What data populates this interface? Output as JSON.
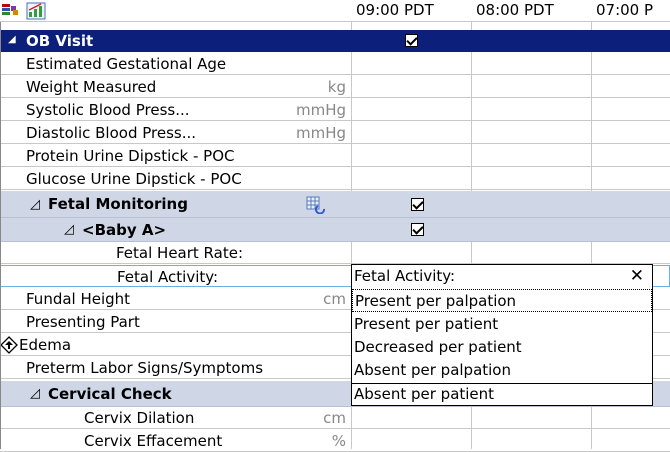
{
  "header": {
    "columns": [
      "09:00 PDT",
      "08:00 PDT",
      "07:00 P"
    ]
  },
  "section": {
    "title": "OB Visit"
  },
  "rows": [
    {
      "label": "Estimated Gestational Age",
      "unit": ""
    },
    {
      "label": "Weight Measured",
      "unit": "kg"
    },
    {
      "label": "Systolic Blood Press...",
      "unit": "mmHg"
    },
    {
      "label": "Diastolic Blood Press...",
      "unit": "mmHg"
    },
    {
      "label": "Protein Urine Dipstick - POC",
      "unit": ""
    },
    {
      "label": "Glucose Urine Dipstick - POC",
      "unit": ""
    }
  ],
  "fetal_monitoring": {
    "label": "Fetal Monitoring"
  },
  "baby": {
    "label": "<Baby A>"
  },
  "fetal_rows": [
    {
      "label": "Fetal Heart Rate:"
    },
    {
      "label": "Fetal Activity:"
    }
  ],
  "rows2": [
    {
      "label": "Fundal Height",
      "unit": "cm"
    },
    {
      "label": "Presenting Part",
      "unit": ""
    },
    {
      "label": "Edema",
      "unit": ""
    },
    {
      "label": "Preterm Labor Signs/Symptoms",
      "unit": ""
    }
  ],
  "cervical": {
    "label": "Cervical Check"
  },
  "rows3": [
    {
      "label": "Cervix Dilation",
      "unit": "cm"
    },
    {
      "label": "Cervix Effacement",
      "unit": "%"
    }
  ],
  "popup": {
    "title": "Fetal Activity:",
    "options": [
      "Present per palpation",
      "Present per patient",
      "Decreased per patient",
      "Absent per palpation",
      "Absent per patient"
    ]
  }
}
